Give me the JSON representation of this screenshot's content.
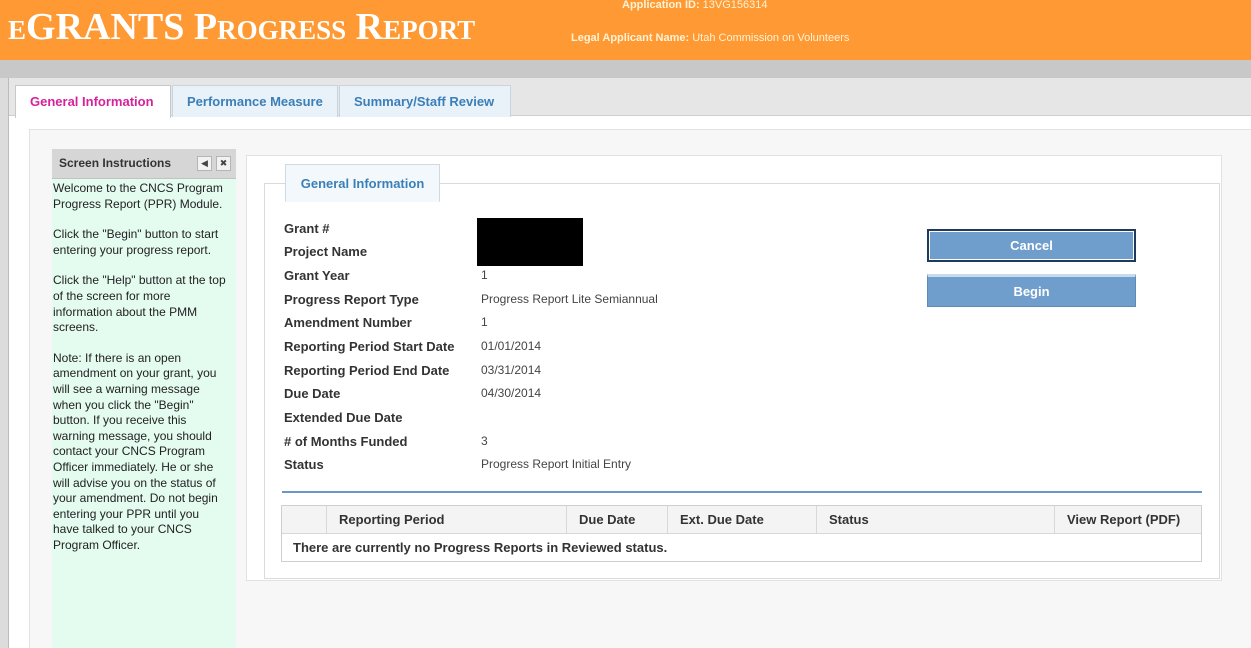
{
  "header": {
    "brand": "eGRANTS Progress Report",
    "application_id_label": "Application ID:",
    "application_id": "13VG156314",
    "legal_applicant_label": "Legal Applicant Name:",
    "legal_applicant": "Utah Commission on Volunteers",
    "background_color": "#ff9933"
  },
  "tabs": [
    {
      "label": "General Information",
      "active": true
    },
    {
      "label": "Performance Measure",
      "active": false
    },
    {
      "label": "Summary/Staff Review",
      "active": false
    }
  ],
  "instructions": {
    "title": "Screen Instructions",
    "collapse_icon": "triangle-left-icon",
    "close_icon": "close-icon",
    "paragraphs": [
      "Welcome to the CNCS Program Progress Report (PPR) Module.",
      "Click the \"Begin\" button to start entering your progress report.",
      "Click the \"Help\" button at the top of the screen for more information about the PMM screens.",
      "Note:  If there is an open amendment on your grant, you will see a warning message when you click the \"Begin\" button.  If you receive this warning message, you should contact your CNCS Program Officer immediately.  He or she will advise you on the status of your amendment.  Do not begin entering your PPR until you have talked to your CNCS Program Officer."
    ]
  },
  "general": {
    "section_tab": "General Information",
    "fields": [
      {
        "label": "Grant #",
        "value": ""
      },
      {
        "label": "Project Name",
        "value": ""
      },
      {
        "label": "Grant Year",
        "value": "1"
      },
      {
        "label": "Progress Report Type",
        "value": "Progress Report Lite Semiannual"
      },
      {
        "label": "Amendment Number",
        "value": "1"
      },
      {
        "label": "Reporting Period Start Date",
        "value": "01/01/2014"
      },
      {
        "label": "Reporting Period End Date",
        "value": "03/31/2014"
      },
      {
        "label": "Due Date",
        "value": "04/30/2014"
      },
      {
        "label": "Extended Due Date",
        "value": ""
      },
      {
        "label": "# of Months Funded",
        "value": "3"
      },
      {
        "label": "Status",
        "value": "Progress Report Initial Entry"
      }
    ],
    "buttons": {
      "cancel": "Cancel",
      "begin": "Begin"
    }
  },
  "reports_table": {
    "columns": [
      "",
      "Reporting Period",
      "Due Date",
      "Ext. Due Date",
      "Status",
      "View Report (PDF)"
    ],
    "empty_message": "There are currently no Progress Reports in Reviewed status."
  }
}
